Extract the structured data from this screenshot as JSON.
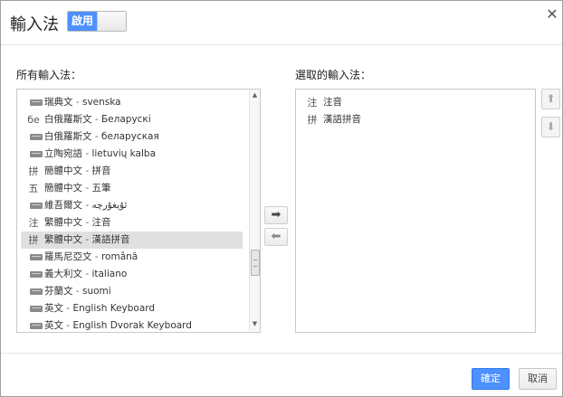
{
  "dialog": {
    "title": "輸入法",
    "toggle_label": "啟用",
    "close_label": "✕"
  },
  "available": {
    "label": "所有輸入法：",
    "items": [
      {
        "icon": "keyboard",
        "lang": "瑞典文",
        "native": "svenska",
        "selected": false
      },
      {
        "icon": "text",
        "glyph": "бе",
        "lang": "白俄羅斯文",
        "native": "Беларускі",
        "selected": false
      },
      {
        "icon": "keyboard",
        "lang": "白俄羅斯文",
        "native": "беларуская",
        "selected": false
      },
      {
        "icon": "keyboard",
        "lang": "立陶宛語",
        "native": "lietuvių kalba",
        "selected": false
      },
      {
        "icon": "text",
        "glyph": "拼",
        "lang": "簡體中文",
        "native": "拼音",
        "selected": false
      },
      {
        "icon": "text",
        "glyph": "五",
        "lang": "簡體中文",
        "native": "五筆",
        "selected": false
      },
      {
        "icon": "keyboard",
        "lang": "維吾爾文",
        "native": "ئۇيغۇرچە",
        "selected": false
      },
      {
        "icon": "text",
        "glyph": "注",
        "lang": "繁體中文",
        "native": "注音",
        "selected": false
      },
      {
        "icon": "text",
        "glyph": "拼",
        "lang": "繁體中文",
        "native": "漢語拼音",
        "selected": true
      },
      {
        "icon": "keyboard",
        "lang": "羅馬尼亞文",
        "native": "română",
        "selected": false
      },
      {
        "icon": "keyboard",
        "lang": "義大利文",
        "native": "italiano",
        "selected": false
      },
      {
        "icon": "keyboard",
        "lang": "芬蘭文",
        "native": "suomi",
        "selected": false
      },
      {
        "icon": "keyboard",
        "lang": "英文",
        "native": "English Keyboard",
        "selected": false
      },
      {
        "icon": "keyboard",
        "lang": "英文",
        "native": "English Dvorak Keyboard",
        "selected": false
      }
    ],
    "separator": " - ",
    "scroll_fraction": 0.72
  },
  "transfer": {
    "add_label": "➡",
    "remove_label": "⬅"
  },
  "chosen": {
    "label": "選取的輸入法：",
    "items": [
      {
        "glyph": "注",
        "name": "注音"
      },
      {
        "glyph": "拼",
        "name": "漢語拼音"
      }
    ],
    "up_label": "⬆",
    "down_label": "⬇"
  },
  "footer": {
    "ok_label": "確定",
    "cancel_label": "取消"
  },
  "colors": {
    "accent": "#4d90fe",
    "selected_row": "#e0e0e0"
  }
}
